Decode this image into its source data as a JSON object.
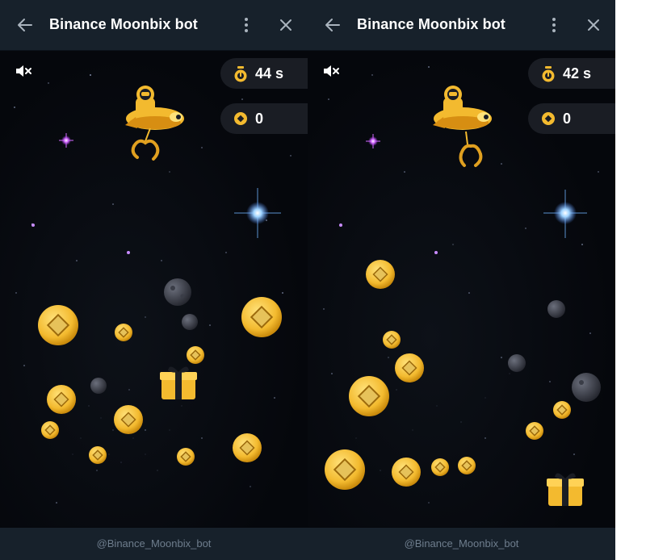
{
  "colors": {
    "titlebar_bg": "#17212b",
    "game_bg": "#05070c",
    "coin": "#f3ba2f",
    "footer_text": "#6e7d8d"
  },
  "panels": [
    {
      "title": "Binance Moonbix bot",
      "timer": "44 s",
      "score": "0",
      "footer": "@Binance_Moonbix_bot"
    },
    {
      "title": "Binance Moonbix bot",
      "timer": "42 s",
      "score": "0",
      "footer": "@Binance_Moonbix_bot"
    }
  ],
  "icons": {
    "back": "arrow-left-icon",
    "more": "more-vertical-icon",
    "close": "close-icon",
    "mute": "speaker-muted-icon",
    "timer": "stopwatch-icon",
    "score": "coin-icon"
  }
}
